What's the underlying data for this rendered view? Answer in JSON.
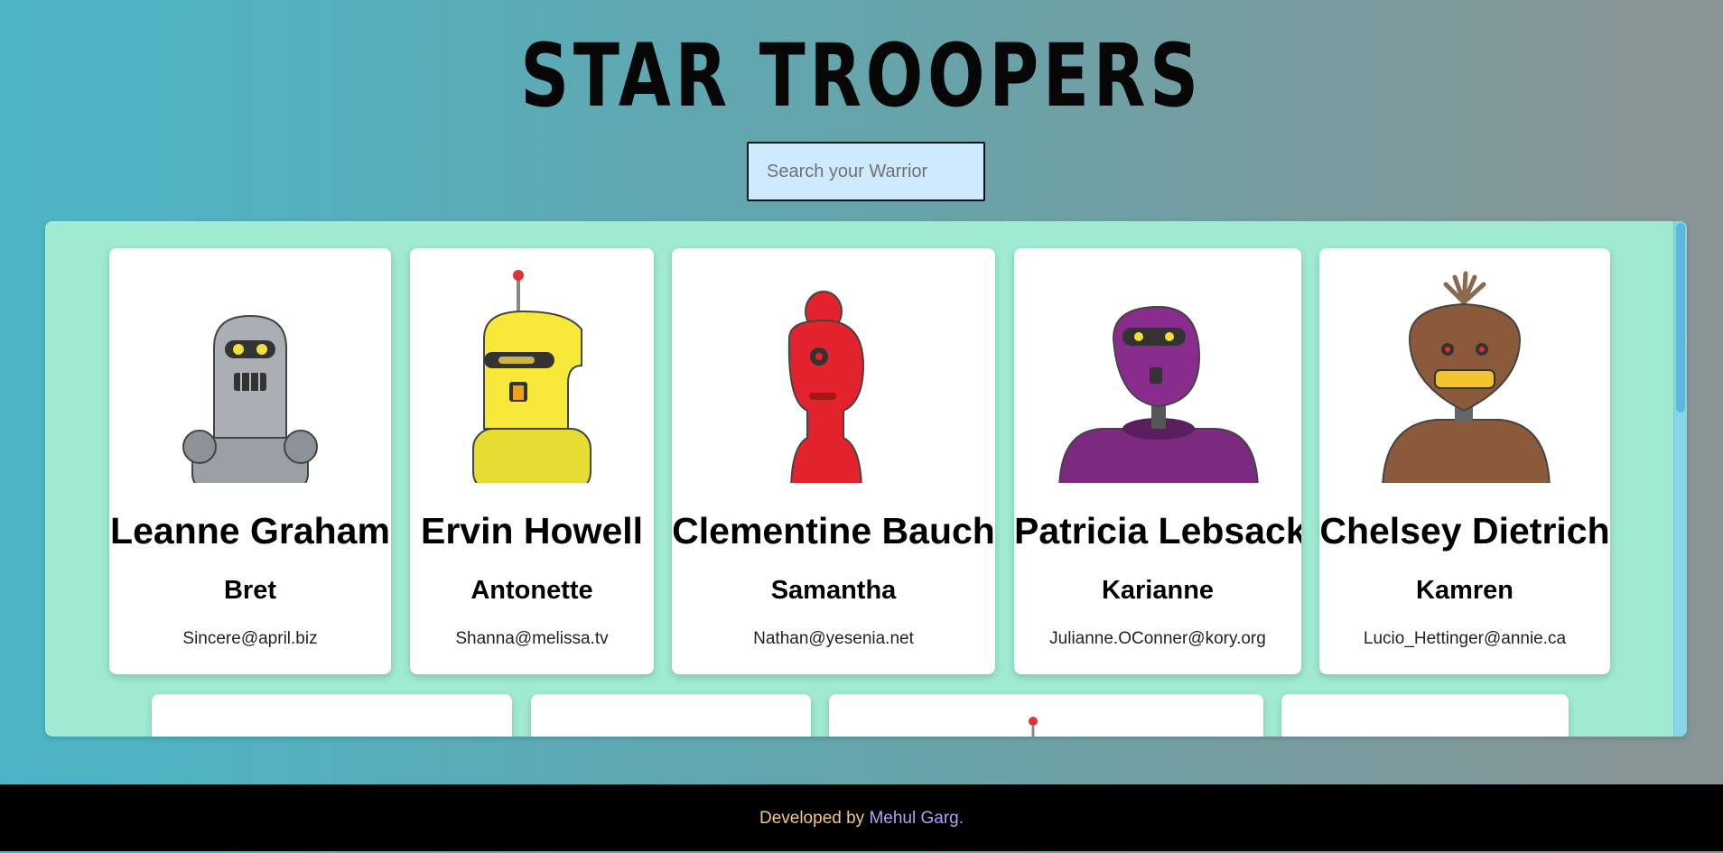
{
  "header": {
    "title": "STAR TROOPERS"
  },
  "search": {
    "placeholder": "Search your Warrior"
  },
  "cards": [
    {
      "name": "Leanne Graham",
      "username": "Bret",
      "email": "Sincere@april.biz",
      "color": "#9aa0a6"
    },
    {
      "name": "Ervin Howell",
      "username": "Antonette",
      "email": "Shanna@melissa.tv",
      "color": "#f7e839"
    },
    {
      "name": "Clementine Bauch",
      "username": "Samantha",
      "email": "Nathan@yesenia.net",
      "color": "#e3232b"
    },
    {
      "name": "Patricia Lebsack",
      "username": "Karianne",
      "email": "Julianne.OConner@kory.org",
      "color": "#8a2c8e"
    },
    {
      "name": "Chelsey Dietrich",
      "username": "Kamren",
      "email": "Lucio_Hettinger@annie.ca",
      "color": "#8a5a3a"
    }
  ],
  "footer": {
    "prefix": "Developed by ",
    "author": "Mehul Garg",
    "suffix": "."
  },
  "colors": {
    "panel": "#9fead0",
    "footer_bg": "#000000",
    "search_bg": "#cfe9ff"
  }
}
